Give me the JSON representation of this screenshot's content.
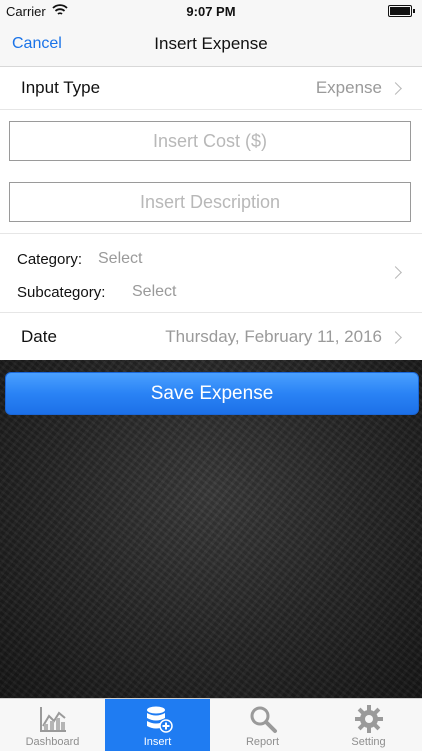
{
  "status_bar": {
    "carrier": "Carrier",
    "time": "9:07 PM"
  },
  "nav": {
    "cancel_label": "Cancel",
    "title": "Insert Expense"
  },
  "form": {
    "input_type": {
      "label": "Input Type",
      "value": "Expense"
    },
    "cost": {
      "placeholder": "Insert Cost ($)",
      "value": ""
    },
    "description": {
      "placeholder": "Insert Description",
      "value": ""
    },
    "category": {
      "label": "Category:",
      "value": "Select"
    },
    "subcategory": {
      "label": "Subcategory:",
      "value": "Select"
    },
    "date": {
      "label": "Date",
      "value": "Thursday, February 11, 2016"
    }
  },
  "save_label": "Save Expense",
  "colors": {
    "accent": "#1f7cf2",
    "button_top": "#4aa0ff",
    "button_bottom": "#1c70e8"
  },
  "tabs": [
    {
      "label": "Dashboard",
      "icon": "chart-icon",
      "active": false
    },
    {
      "label": "Insert",
      "icon": "database-add-icon",
      "active": true
    },
    {
      "label": "Report",
      "icon": "search-icon",
      "active": false
    },
    {
      "label": "Setting",
      "icon": "gear-icon",
      "active": false
    }
  ]
}
